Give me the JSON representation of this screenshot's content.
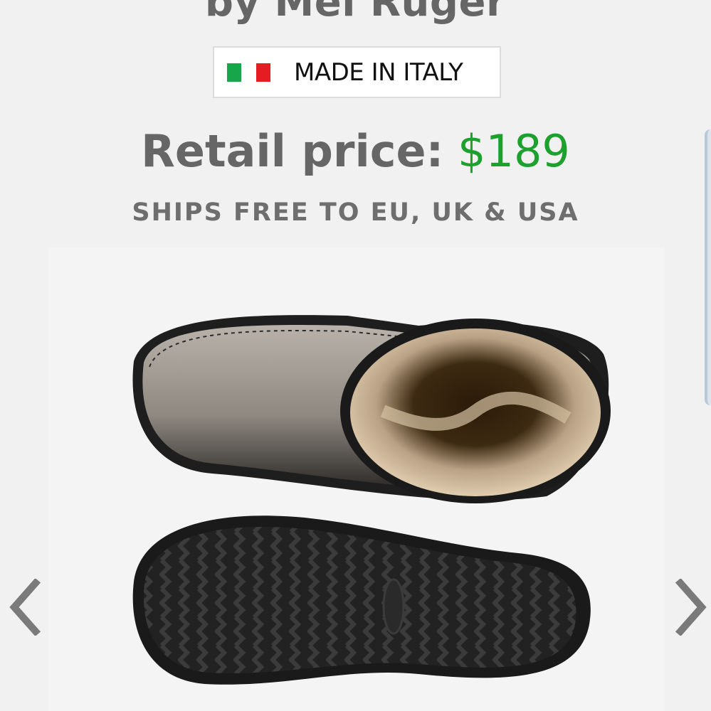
{
  "product": {
    "designer": "by Mel Ruger",
    "origin_badge": {
      "text": "MADE IN ITALY",
      "flag_colors": [
        "#17a64a",
        "#ffffff",
        "#e51c22"
      ]
    },
    "price": {
      "label": "Retail price:",
      "value": "$189",
      "value_color": "#1da02e"
    },
    "shipping": "SHIPS FREE TO EU, UK & USA"
  },
  "gallery": {
    "image": "boot-top-and-sole-view",
    "prev_icon": "chevron-left-icon",
    "next_icon": "chevron-right-icon"
  }
}
